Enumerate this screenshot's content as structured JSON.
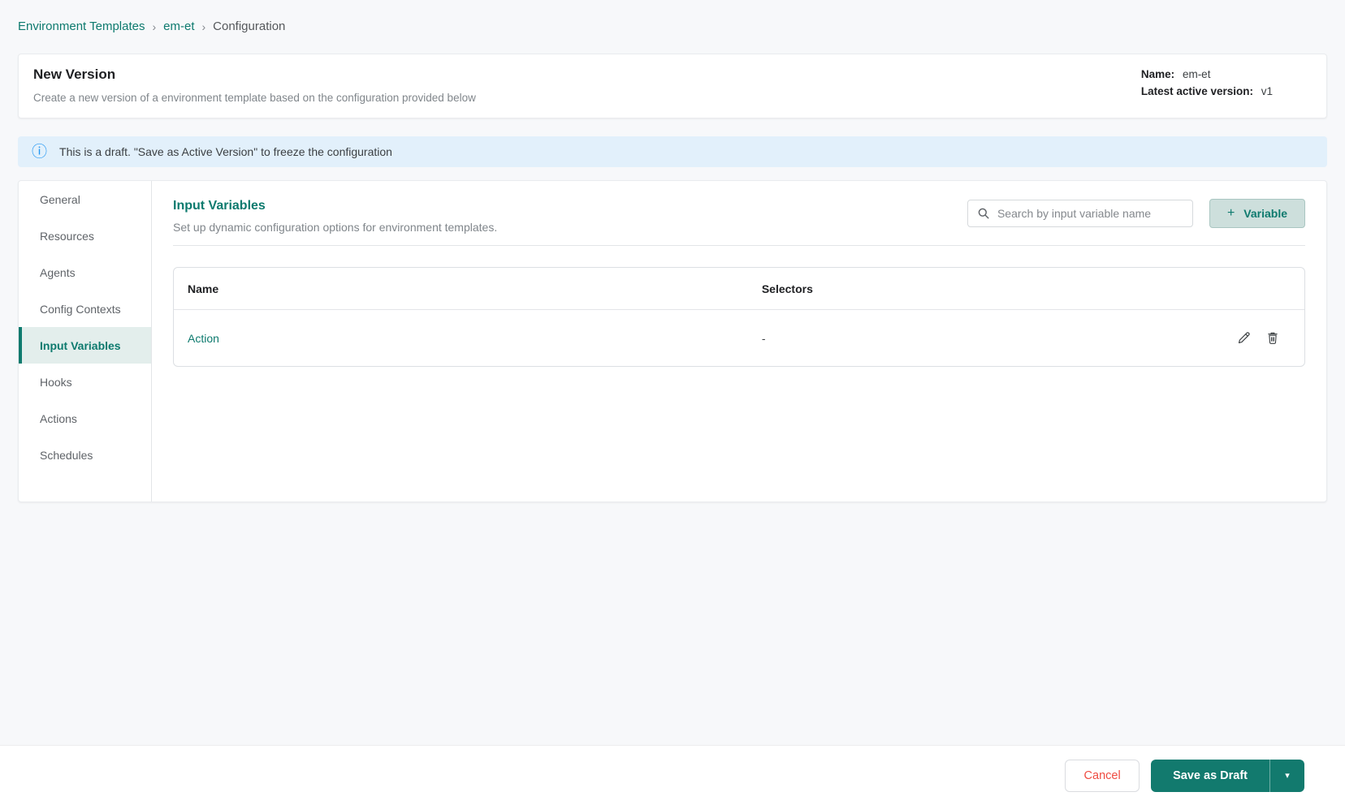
{
  "breadcrumb": {
    "separator": "›",
    "items": [
      {
        "label": "Environment Templates"
      },
      {
        "label": "em-et"
      },
      {
        "label": "Configuration"
      }
    ]
  },
  "header": {
    "title": "New Version",
    "subtitle": "Create a new version of a environment template based on the configuration provided below",
    "name_label": "Name:",
    "name_value": "em-et",
    "version_label": "Latest active version:",
    "version_value": "v1"
  },
  "banner": {
    "icon": "info-icon",
    "icon_glyph": "ⓘ",
    "text": "This is a draft. \"Save as Active Version\" to freeze the configuration"
  },
  "sidebar": {
    "items": [
      {
        "label": "General",
        "active": false
      },
      {
        "label": "Resources",
        "active": false
      },
      {
        "label": "Agents",
        "active": false
      },
      {
        "label": "Config Contexts",
        "active": false
      },
      {
        "label": "Input Variables",
        "active": true
      },
      {
        "label": "Hooks",
        "active": false
      },
      {
        "label": "Actions",
        "active": false
      },
      {
        "label": "Schedules",
        "active": false
      }
    ]
  },
  "content": {
    "title": "Input Variables",
    "subtitle": "Set up dynamic configuration options for environment templates.",
    "search_placeholder": "Search by input variable name",
    "add_button": {
      "icon": "+",
      "label": "Variable"
    }
  },
  "table": {
    "columns": {
      "name": "Name",
      "selectors": "Selectors"
    },
    "rows": [
      {
        "name": "Action",
        "selectors": "-"
      }
    ]
  },
  "footer": {
    "cancel_label": "Cancel",
    "save_label": "Save as Draft",
    "caret_glyph": "▾"
  },
  "colors": {
    "accent_teal": "#0d7a6e",
    "active_tab_bg": "#e3eeec",
    "variable_btn_bg": "#cddfdc",
    "banner_bg": "#e2f0fb",
    "banner_icon_blue": "#2196f3",
    "page_bg": "#f7f8fa",
    "cancel_red": "#ef4b41",
    "save_btn_bg": "#127a6e"
  }
}
